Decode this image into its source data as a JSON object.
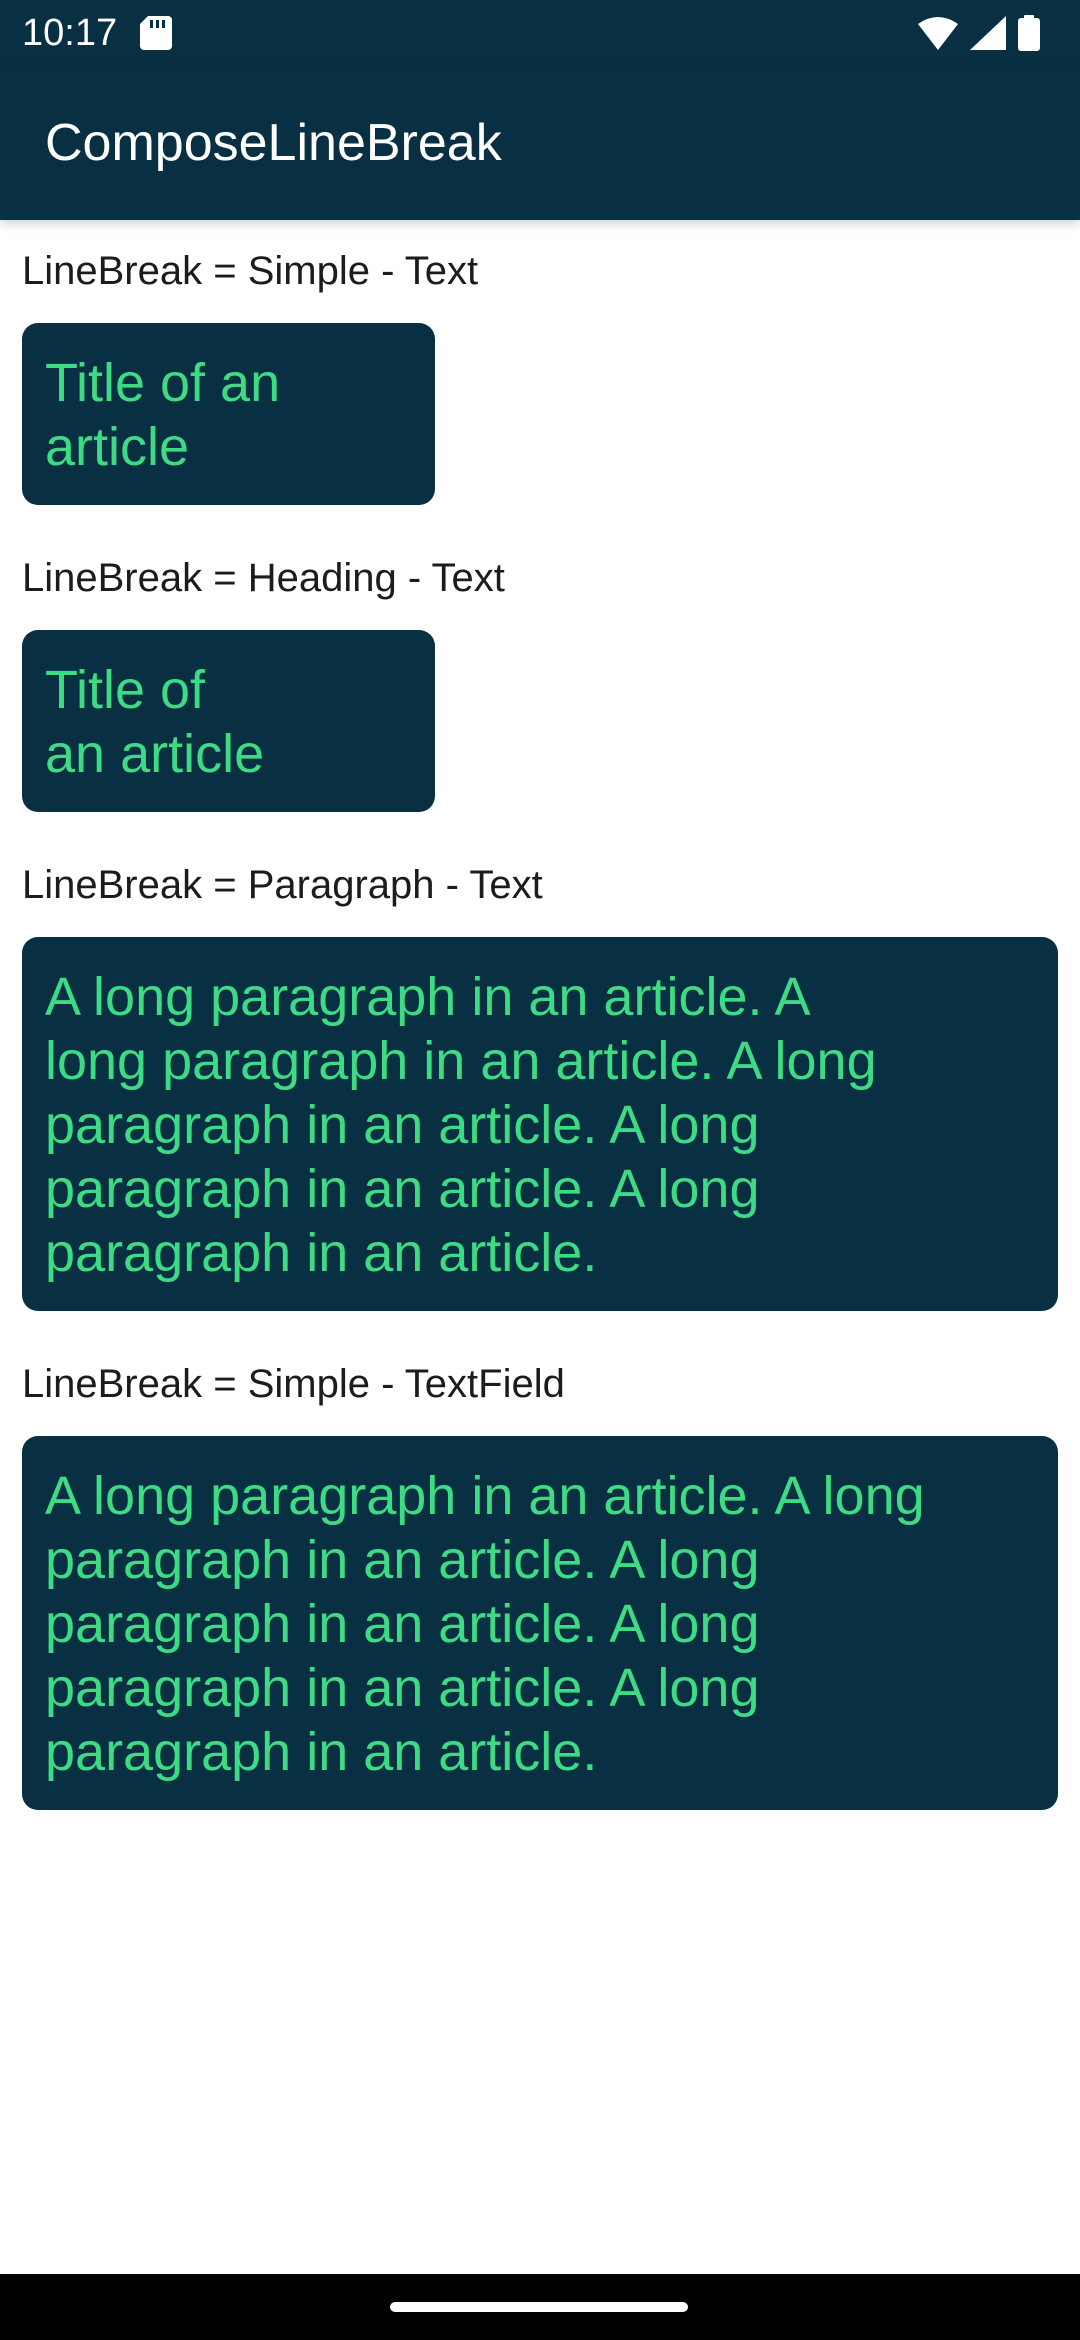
{
  "status_bar": {
    "time": "10:17",
    "icons": [
      "sd-card-icon",
      "wifi-icon",
      "signal-icon",
      "battery-icon"
    ]
  },
  "app_bar": {
    "title": "ComposeLineBreak"
  },
  "sections": [
    {
      "label": "LineBreak = Simple - Text",
      "lines": [
        "Title of an",
        "article"
      ]
    },
    {
      "label": "LineBreak = Heading - Text",
      "lines": [
        "Title of",
        "an article"
      ]
    },
    {
      "label": "LineBreak = Paragraph - Text",
      "lines": [
        "A long paragraph in an article. A",
        "long paragraph in an article. A long",
        "paragraph in an article. A long",
        "paragraph in an article. A long",
        "paragraph in an article."
      ]
    },
    {
      "label": "LineBreak = Simple - TextField",
      "lines": [
        "A long paragraph in an article. A long",
        "paragraph in an article. A long",
        "paragraph in an article. A long",
        "paragraph in an article. A long",
        "paragraph in an article."
      ]
    }
  ],
  "colors": {
    "bar_background": "#082f42",
    "box_background": "#082f42",
    "accent_text": "#3ddc84",
    "label_text": "#1c1c1c"
  }
}
